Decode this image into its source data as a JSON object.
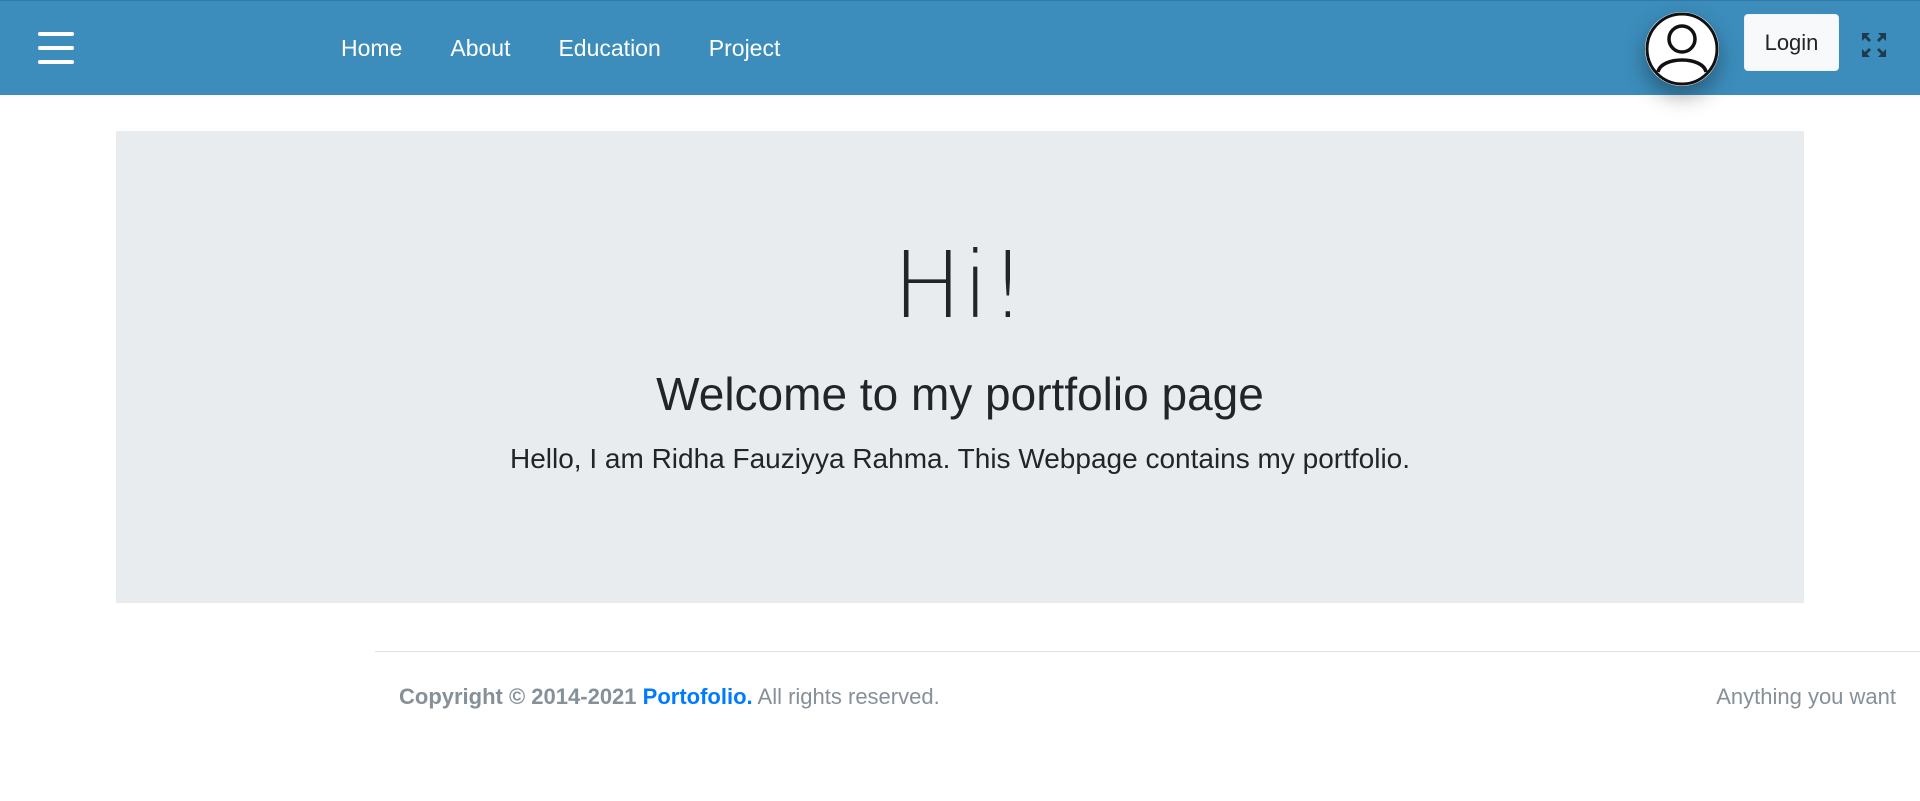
{
  "navbar": {
    "background": "#3c8dbc",
    "menu_icon": "hamburger-menu-icon",
    "links": [
      "Home",
      "About",
      "Education",
      "Project"
    ],
    "avatar_icon": "user-avatar-icon",
    "login_label": "Login",
    "fullscreen_icon": "expand-arrows-icon"
  },
  "hero": {
    "title": "Hi!",
    "subtitle": "Welcome to my portfolio page",
    "lead": "Hello, I am Ridha Fauziyya Rahma. This Webpage contains my portfolio."
  },
  "footer": {
    "copyright_prefix": "Copyright © 2014-2021 ",
    "brand": "Portofolio.",
    "rights": " All rights reserved.",
    "right_text": "Anything you want",
    "brand_color": "#007bff"
  }
}
